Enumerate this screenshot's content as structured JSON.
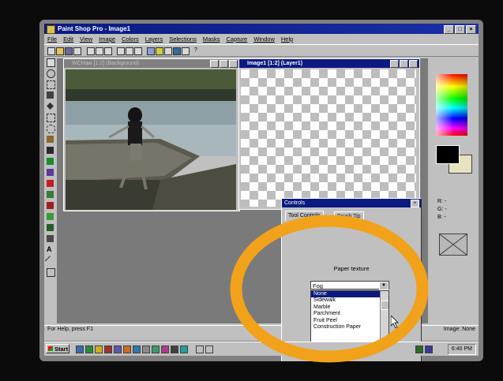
{
  "app": {
    "title": "Paint Shop Pro - Image1"
  },
  "menu": [
    "File",
    "Edit",
    "View",
    "Image",
    "Colors",
    "Layers",
    "Selections",
    "Masks",
    "Capture",
    "Window",
    "Help"
  ],
  "photo_window": {
    "title": "WCHaw [1:2] (Background)"
  },
  "layer_window": {
    "title": "Image1 [1:2] (Layer1)"
  },
  "controls_palette": {
    "title": "Controls",
    "tabs": [
      "Tool Controls",
      "Brush Tip"
    ],
    "paper_texture_label": "Paper texture",
    "selected_value": "Fog",
    "options": [
      "None",
      "Sidewalk",
      "Marble",
      "Parchment",
      "Fruit Peel",
      "Construction Paper"
    ],
    "highlighted_option": "None"
  },
  "color_panel": {
    "r_label": "R: -",
    "g_label": "G: -",
    "b_label": "B: -"
  },
  "status": {
    "help_text": "For Help, press F1",
    "image_text": "Image: None"
  },
  "taskbar": {
    "start_label": "Start",
    "clock": "6:40 PM"
  },
  "colors": {
    "title_bar": "#0a1a80",
    "highlight_ring": "#f2a21a",
    "chrome": "#c0c0c0"
  }
}
